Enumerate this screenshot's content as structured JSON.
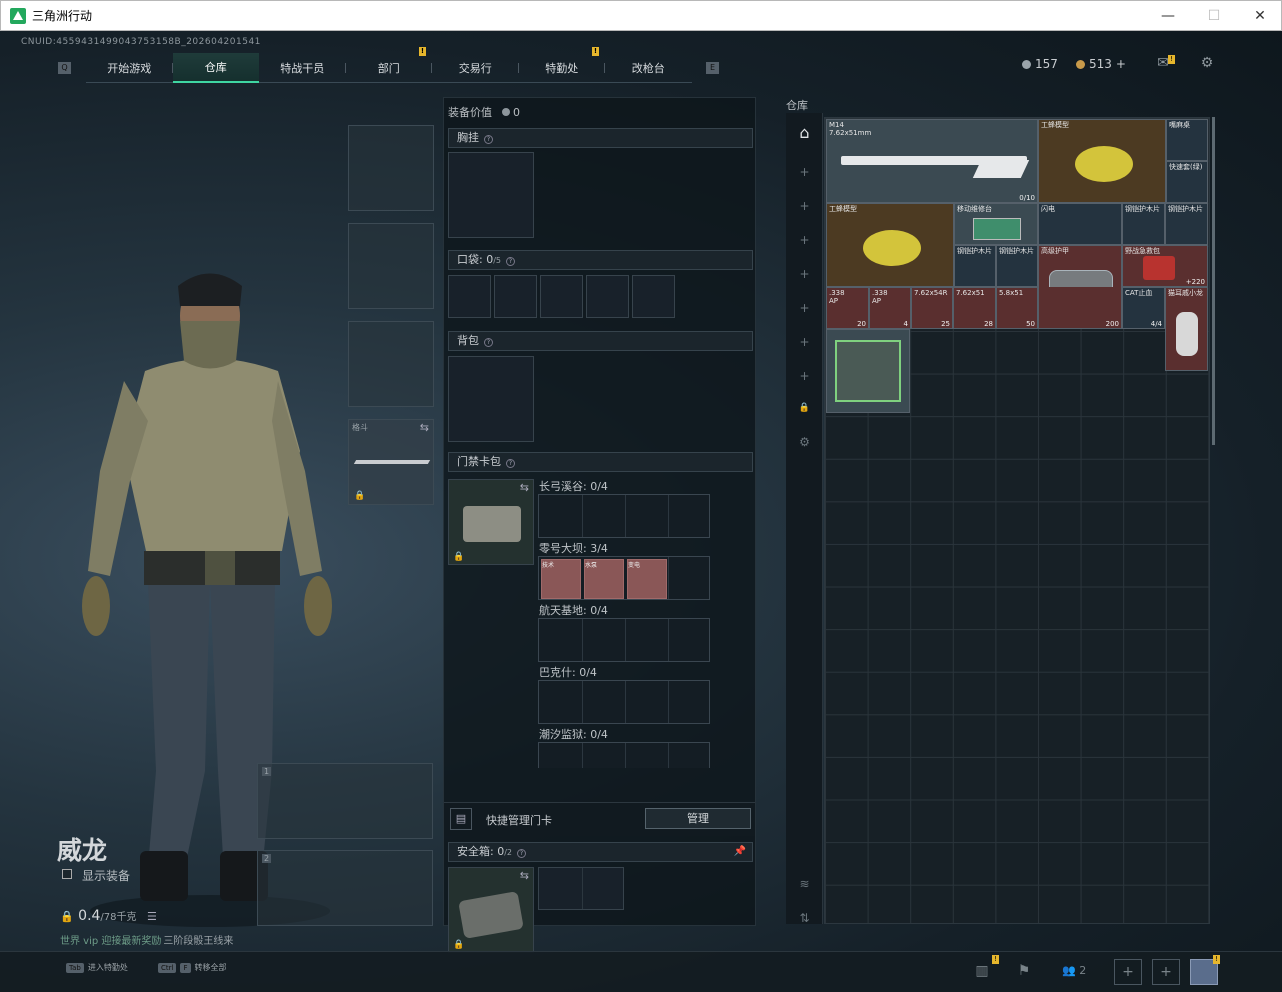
{
  "window": {
    "title": "三角洲行动",
    "minimize": "—",
    "maximize": "☐",
    "close": "✕"
  },
  "uid": "CNUID:4559431499043753158B_202604201541",
  "nav": {
    "tabs": [
      "开始游戏",
      "仓库",
      "特战干员",
      "部门",
      "交易行",
      "特勤处",
      "改枪台"
    ],
    "active": "仓库",
    "key_left": "Q",
    "key_right": "E",
    "badge": "!"
  },
  "currency": {
    "silver": "157",
    "gold": "513",
    "plus": "+"
  },
  "character": {
    "name": "威龙",
    "show_equipment": "显示装备",
    "weight": "0.4",
    "weight_unit": "/78千克",
    "hint_prefix": "世界 vip 迎接最新奖励",
    "hint_suffix": "三阶段骰王线来"
  },
  "equipment_slots": {
    "melee_label": "格斗",
    "primary_1": "1",
    "primary_2": "2"
  },
  "center": {
    "value_label": "装备价值",
    "value": "0",
    "chest_rig": "胸挂",
    "pocket": "口袋:",
    "pocket_count": "0",
    "pocket_max": "/5",
    "backpack": "背包",
    "keycard_pack": "门禁卡包",
    "maps": [
      {
        "name": "长弓溪谷:",
        "count": "0/4"
      },
      {
        "name": "零号大坝:",
        "count": "3/4"
      },
      {
        "name": "航天基地:",
        "count": "0/4"
      },
      {
        "name": "巴克什:",
        "count": "0/4"
      },
      {
        "name": "潮汐监狱:",
        "count": "0/4"
      }
    ],
    "dam_cards": [
      "技术",
      "水泵",
      "变电"
    ],
    "quick_manage": "快捷管理门卡",
    "manage_btn": "管理",
    "safe_box": "安全箱:",
    "safe_count": "0",
    "safe_max": "/2"
  },
  "warehouse": {
    "label": "仓库",
    "items": [
      {
        "name": "M14\n7.62x51mm",
        "count": "0/10"
      },
      {
        "name": "工蜂模型",
        "count": ""
      },
      {
        "name": "嘴麻桌",
        "count": ""
      },
      {
        "name": "快速套(绿)",
        "count": ""
      },
      {
        "name": "工蜂模型",
        "count": ""
      },
      {
        "name": "移动维修台",
        "count": ""
      },
      {
        "name": "闪电",
        "count": ""
      },
      {
        "name": "钢铠护木片",
        "count": ""
      },
      {
        "name": "钢铠护木片",
        "count": ""
      },
      {
        "name": "钢铠护木片",
        "count": ""
      },
      {
        "name": "钢铠护木片",
        "count": ""
      },
      {
        "name": "高级护甲",
        "count": ""
      },
      {
        "name": "野战急救包",
        "count": "+220"
      },
      {
        "name": ".338\nAP",
        "count": "20"
      },
      {
        "name": ".338\nAP",
        "count": "4"
      },
      {
        "name": "7.62x54R",
        "count": "25"
      },
      {
        "name": "7.62x51",
        "count": "28"
      },
      {
        "name": "5.8x51",
        "count": "50"
      },
      {
        "name": "",
        "count": "200"
      },
      {
        "name": "CAT止血",
        "count": "4/4"
      },
      {
        "name": "猫耳戚小龙",
        "count": ""
      }
    ]
  },
  "bottom": {
    "tab_key": "Tab",
    "tab_label": "进入特勤处",
    "ctrl_key": "Ctrl",
    "f_key": "F",
    "f_label": "转移全部",
    "party_count": "2"
  },
  "colors": {
    "accent": "#3fd6a2",
    "badge": "#e6b62c",
    "panel": "#0e161b"
  }
}
